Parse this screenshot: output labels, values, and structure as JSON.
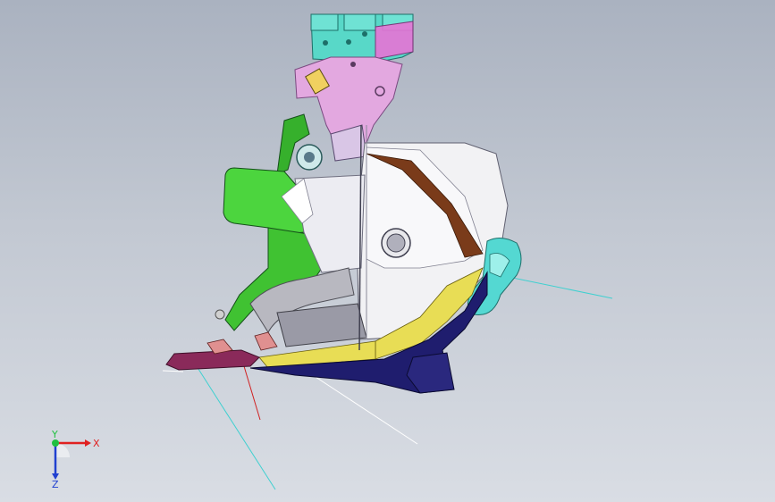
{
  "viewport": {
    "background_top": "#aab2c0",
    "background_bottom": "#d9dde4"
  },
  "model": {
    "part_colors": {
      "bracket": "#58d8c8",
      "mount": "#e3a8e0",
      "housing": "#4cd53e",
      "shell": "#f2f2f4",
      "bezel": "#1f1d6e",
      "trim": "#e8dd55",
      "lens": "#7a3b1a",
      "clip": "#54d8d2",
      "tab": "#8a2a5a"
    }
  },
  "triad": {
    "x_label": "X",
    "y_label": "Y",
    "z_label": "Z",
    "x_color": "#e02020",
    "y_color": "#20c040",
    "z_color": "#2040d0"
  }
}
